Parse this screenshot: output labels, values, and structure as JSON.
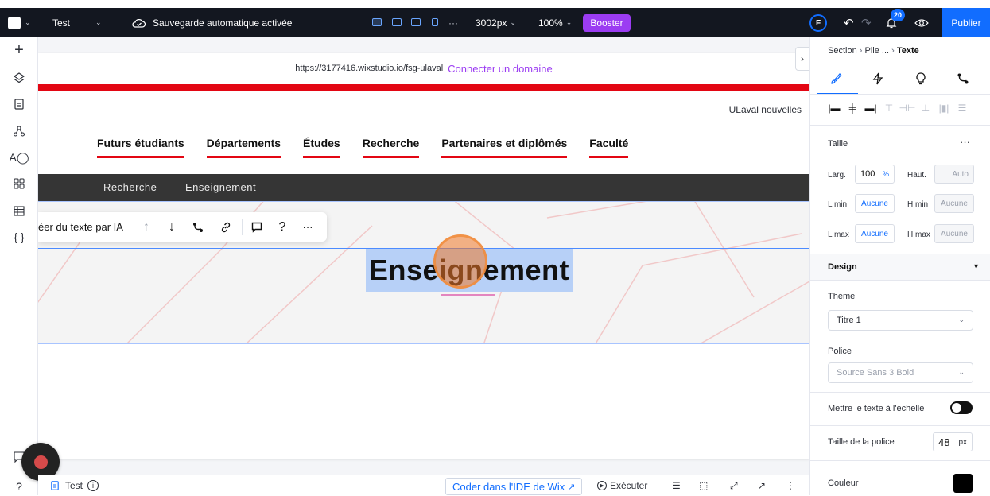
{
  "topbar": {
    "site_name": "Test",
    "autosave": "Sauvegarde automatique activée",
    "width_value": "3002px",
    "zoom": "100%",
    "booster": "Booster",
    "user_initial": "F",
    "notifications": "20",
    "publish": "Publier",
    "more": "···"
  },
  "canvas": {
    "url": "https://3177416.wixstudio.io/fsg-ulaval",
    "connect_domain": "Connecter un domaine",
    "news_link": "ULaval nouvelles",
    "nav": [
      "Futurs étudiants",
      "Départements",
      "Études",
      "Recherche",
      "Partenaires et diplômés",
      "Faculté"
    ],
    "subnav": [
      "Recherche",
      "Enseignement"
    ],
    "heading": "Enseignement"
  },
  "ai_toolbar": {
    "label": "éer du texte par IA",
    "help": "?",
    "more": "···"
  },
  "bottombar": {
    "page_name": "Test",
    "code_ide": "Coder dans l'IDE de Wix",
    "run": "Exécuter"
  },
  "panel": {
    "crumb_section": "Section",
    "crumb_pile": "Pile ...",
    "crumb_text": "Texte",
    "size_title": "Taille",
    "size_more": "···",
    "width_label": "Larg.",
    "width_value": "100",
    "width_unit": "%",
    "height_label": "Haut.",
    "height_value": "Auto",
    "lmin_label": "L min",
    "lmin_value": "Aucune",
    "hmin_label": "H min",
    "hmin_value": "Aucune",
    "lmax_label": "L max",
    "lmax_value": "Aucune",
    "hmax_label": "H max",
    "hmax_value": "Aucune",
    "design_title": "Design",
    "theme_label": "Thème",
    "theme_value": "Titre 1",
    "font_label": "Police",
    "font_value": "Source Sans 3 Bold",
    "scale_label": "Mettre le texte à l'échelle",
    "font_size_label": "Taille de la police",
    "font_size_value": "48",
    "font_size_unit": "px",
    "color_label": "Couleur"
  },
  "colors": {
    "accent": "#116dff",
    "booster": "#9b3cf2",
    "brand_red": "#e30613",
    "topbar": "#131720"
  }
}
